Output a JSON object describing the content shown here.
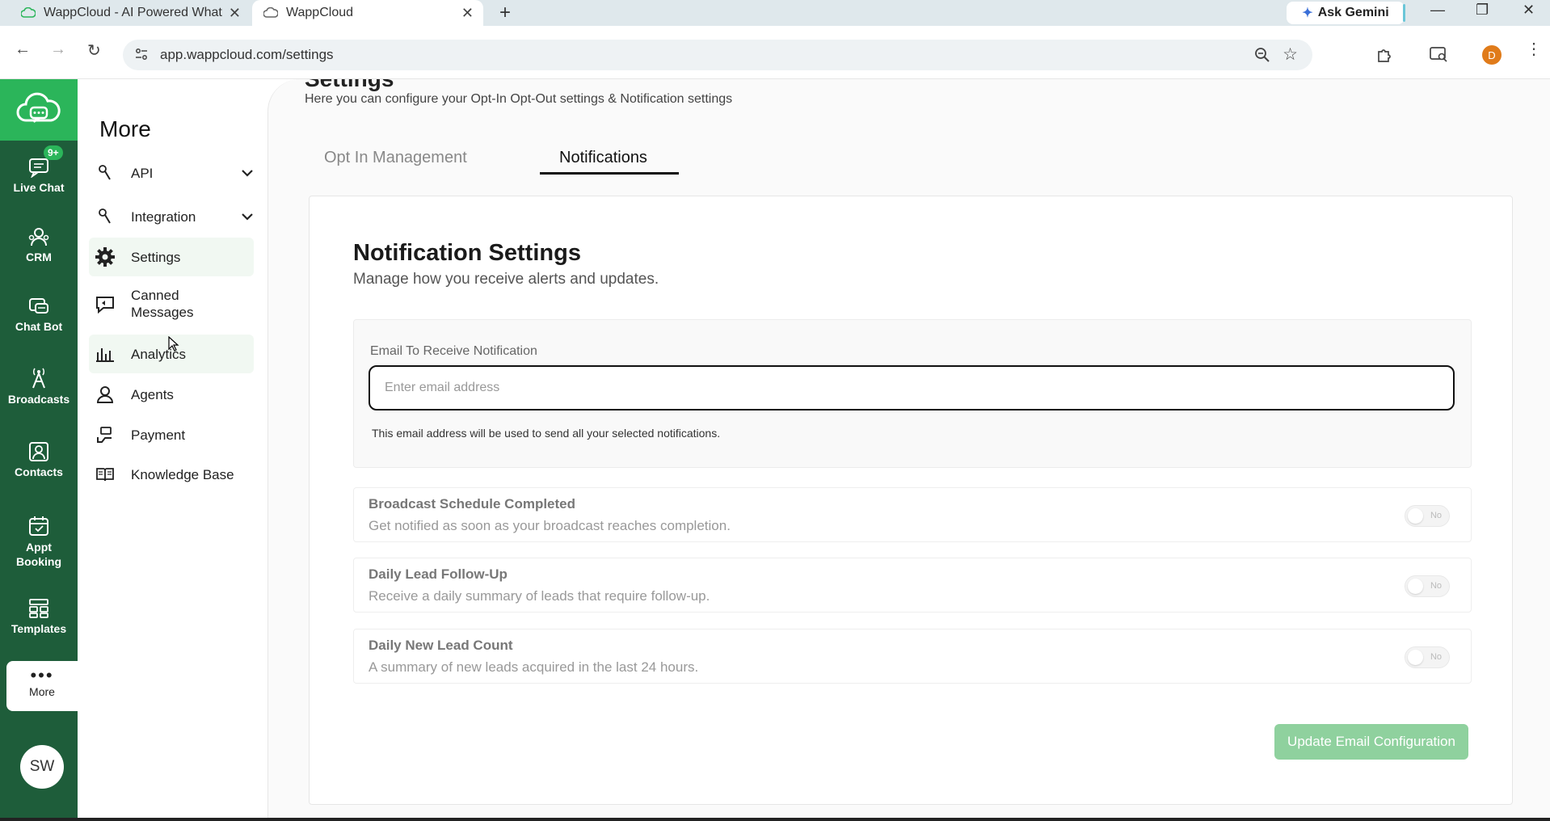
{
  "browser": {
    "tabs": [
      {
        "title": "WappCloud - AI Powered What",
        "active": false
      },
      {
        "title": "WappCloud",
        "active": true
      }
    ],
    "gemini_label": "Ask Gemini",
    "url": "app.wappcloud.com/settings",
    "profile_initial": "D"
  },
  "rail": {
    "live_chat_badge": "9+",
    "items": [
      {
        "label": "Live Chat",
        "icon": "chat-icon"
      },
      {
        "label": "CRM",
        "icon": "crm-icon"
      },
      {
        "label": "Chat Bot",
        "icon": "chatbot-icon"
      },
      {
        "label": "Broadcasts",
        "icon": "broadcast-icon"
      },
      {
        "label": "Contacts",
        "icon": "contacts-icon"
      },
      {
        "label": "Appt Booking",
        "icon": "calendar-icon"
      },
      {
        "label": "Templates",
        "icon": "templates-icon"
      }
    ],
    "more_label": "More",
    "avatar_initials": "SW",
    "colors": {
      "rail_bg": "#1e5d3a",
      "accent": "#2bb55a"
    }
  },
  "submenu": {
    "title": "More",
    "items": [
      {
        "label": "API",
        "icon": "api-icon",
        "expandable": true
      },
      {
        "label": "Integration",
        "icon": "integration-icon",
        "expandable": true
      },
      {
        "label": "Settings",
        "icon": "gear-icon",
        "active": true
      },
      {
        "label": "Canned Messages",
        "icon": "canned-messages-icon"
      },
      {
        "label": "Analytics",
        "icon": "analytics-icon"
      },
      {
        "label": "Agents",
        "icon": "agents-icon"
      },
      {
        "label": "Payment",
        "icon": "payment-icon"
      },
      {
        "label": "Knowledge Base",
        "icon": "book-icon"
      }
    ]
  },
  "main": {
    "title": "Settings",
    "subtitle": "Here you can configure your Opt-In Opt-Out settings & Notification settings",
    "tabs": [
      {
        "label": "Opt In Management",
        "active": false
      },
      {
        "label": "Notifications",
        "active": true
      }
    ],
    "card": {
      "title": "Notification Settings",
      "subtitle": "Manage how you receive alerts and updates.",
      "email_label": "Email To Receive Notification",
      "email_placeholder": "Enter email address",
      "email_value": "",
      "email_help": "This email address will be used to send all your selected notifications.",
      "notifications": [
        {
          "title": "Broadcast Schedule Completed",
          "description": "Get notified as soon as your broadcast reaches completion.",
          "toggle": "No"
        },
        {
          "title": "Daily Lead Follow-Up",
          "description": "Receive a daily summary of leads that require follow-up.",
          "toggle": "No"
        },
        {
          "title": "Daily New Lead Count",
          "description": "A summary of new leads acquired in the last 24 hours.",
          "toggle": "No"
        }
      ],
      "update_button": "Update Email Configuration",
      "button_color": "#8fd19e"
    }
  }
}
